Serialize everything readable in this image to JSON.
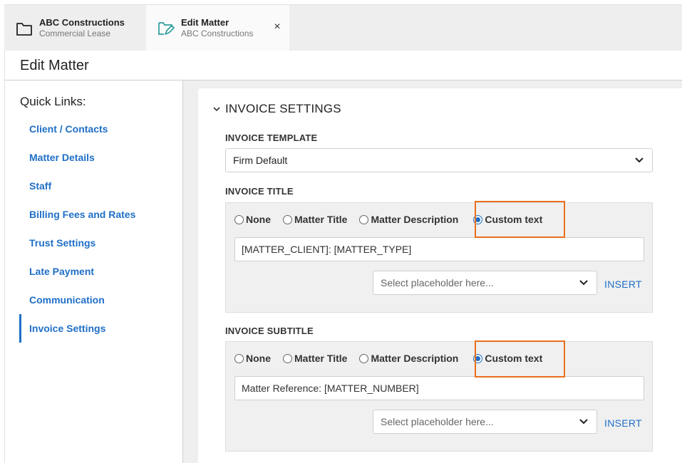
{
  "tabs": [
    {
      "title": "ABC Constructions",
      "subtitle": "Commercial Lease"
    },
    {
      "title": "Edit Matter",
      "subtitle": "ABC Constructions",
      "close": "×"
    }
  ],
  "page": {
    "title": "Edit Matter"
  },
  "sidebar": {
    "heading": "Quick Links:",
    "items": [
      {
        "label": "Client / Contacts"
      },
      {
        "label": "Matter Details"
      },
      {
        "label": "Staff"
      },
      {
        "label": "Billing Fees and Rates"
      },
      {
        "label": "Trust Settings"
      },
      {
        "label": "Late Payment"
      },
      {
        "label": "Communication"
      },
      {
        "label": "Invoice Settings",
        "active": true
      }
    ]
  },
  "invoice": {
    "section_title": "INVOICE SETTINGS",
    "template": {
      "label": "INVOICE TEMPLATE",
      "value": "Firm Default"
    },
    "title": {
      "label": "INVOICE TITLE",
      "options": [
        "None",
        "Matter Title",
        "Matter Description",
        "Custom text"
      ],
      "selected": "Custom text",
      "value": "[MATTER_CLIENT]: [MATTER_TYPE]",
      "placeholder_select": "Select placeholder here...",
      "insert_label": "INSERT"
    },
    "subtitle": {
      "label": "INVOICE SUBTITLE",
      "options": [
        "None",
        "Matter Title",
        "Matter Description",
        "Custom text"
      ],
      "selected": "Custom text",
      "value": "Matter Reference: [MATTER_NUMBER]",
      "placeholder_select": "Select placeholder here...",
      "insert_label": "INSERT"
    }
  },
  "colors": {
    "accent": "#1f6fc7",
    "highlight": "#e8701d",
    "folder_icon_active": "#2a9d9a"
  },
  "icons": [
    "folder-icon",
    "folder-edit-icon",
    "close-icon",
    "chevron-down-icon"
  ]
}
